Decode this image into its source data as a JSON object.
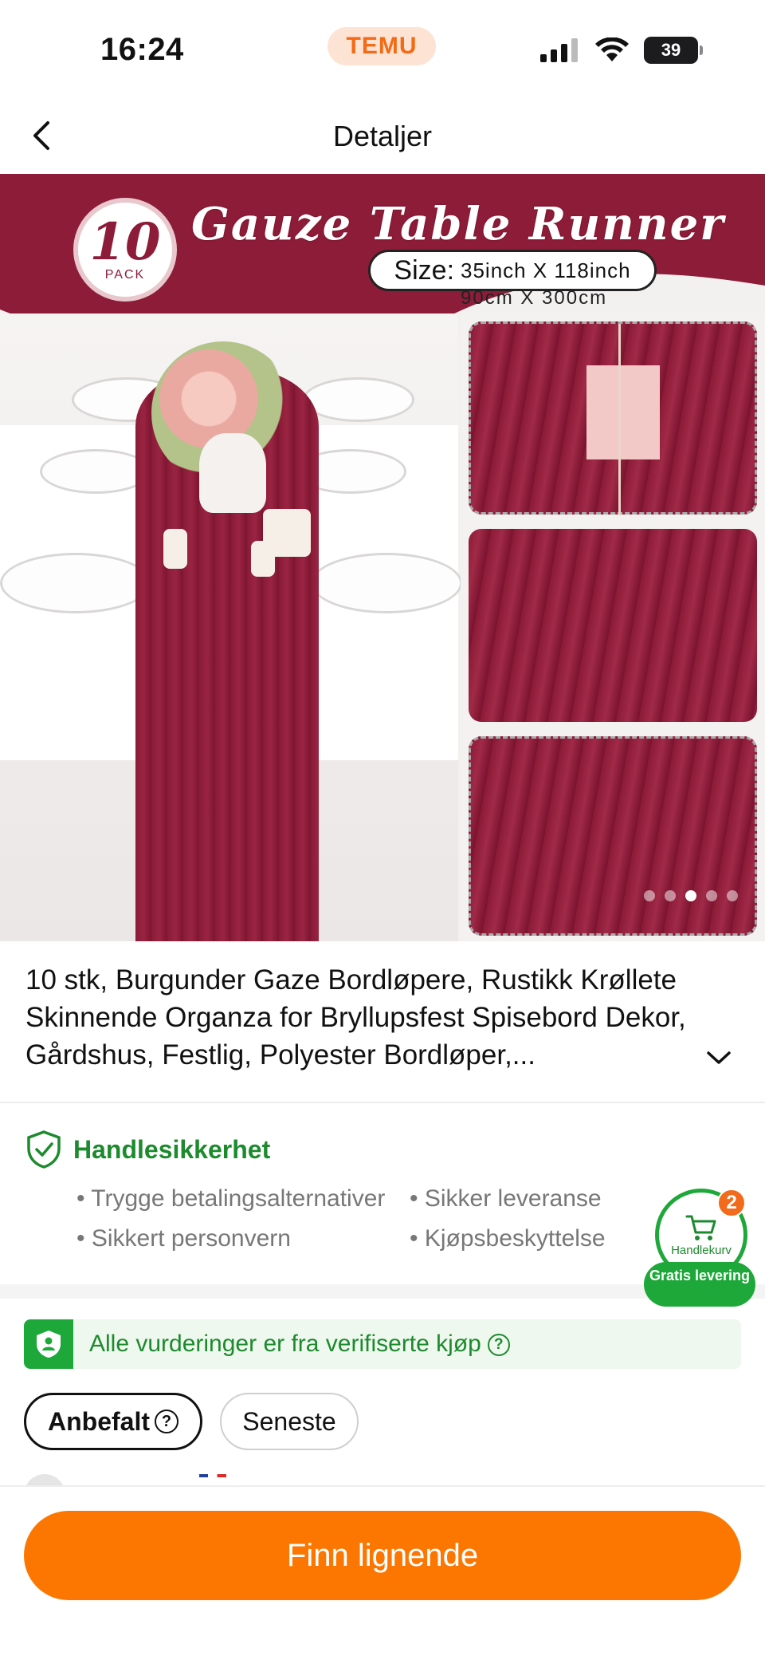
{
  "status_bar": {
    "time": "16:24",
    "brand": "TEMU",
    "battery": "39",
    "icons": [
      "signal-icon",
      "wifi-icon",
      "battery-icon"
    ]
  },
  "nav": {
    "title": "Detaljer",
    "back_icon": "chevron-left-icon"
  },
  "hero_image": {
    "pack_number": "10",
    "pack_label": "PACK",
    "headline": "Gauze Table Runner",
    "size_label": "Size:",
    "size_inch": "35inch X 118inch",
    "size_cm": "90cm X 300cm",
    "carousel_total": 5,
    "carousel_active": 3,
    "colors": {
      "burgundy": "#8d1c38"
    }
  },
  "product": {
    "title": "10 stk, Burgunder Gaze Bordløpere, Rustikk Krøllete Skinnende Organza for Bryllupsfest Spisebord Dekor, Gårdshus, Festlig, Polyester Bordløper,...",
    "expand_icon": "chevron-down-icon"
  },
  "security": {
    "title": "Handlesikkerhet",
    "icon": "shield-check-icon",
    "items": [
      "Trygge betalingsalternativer",
      "Sikker leveranse",
      "Sikkert personvern",
      "Kjøpsbeskyttelse"
    ],
    "accent": "#1d8a2e"
  },
  "cart": {
    "label": "Handlekurv",
    "count": "2",
    "free_shipping": "Gratis levering",
    "icon": "cart-icon"
  },
  "reviews": {
    "verified_text": "Alle vurderinger er fra verifiserte kjøp",
    "verified_icon": "shield-user-icon",
    "help_icon": "question-circle-icon",
    "filters": [
      {
        "label": "Anbefalt",
        "active": true
      },
      {
        "label": "Seneste",
        "active": false
      }
    ]
  },
  "bottom": {
    "cta_label": "Finn lignende",
    "cta_color": "#fb7701"
  }
}
